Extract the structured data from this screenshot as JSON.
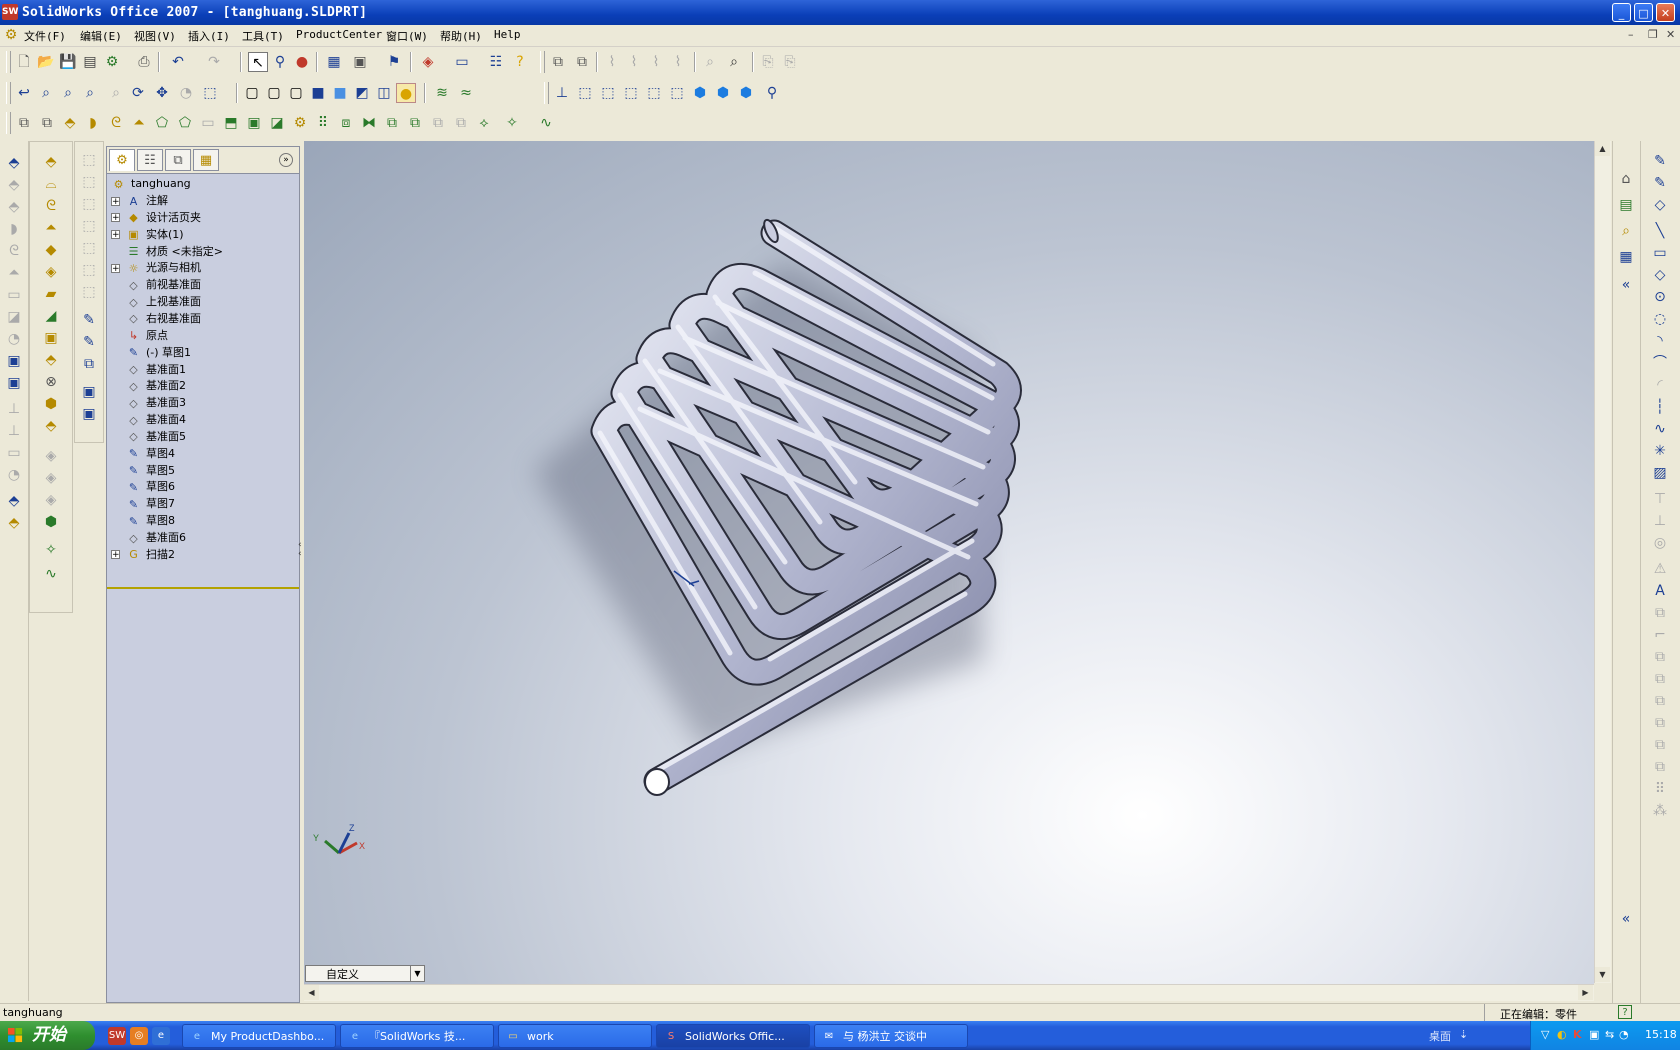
{
  "window": {
    "title": "SolidWorks Office 2007 - [tanghuang.SLDPRT]",
    "logo": "SW",
    "minimize": "_",
    "maximize": "□",
    "close": "✕"
  },
  "menu": {
    "items": [
      "文件(F)",
      "编辑(E)",
      "视图(V)",
      "插入(I)",
      "工具(T)",
      "ProductCenter",
      "窗口(W)",
      "帮助(H)",
      "Help"
    ],
    "doc_min": "–",
    "doc_restore": "❐",
    "doc_close": "✕"
  },
  "tree": {
    "root": "tanghuang",
    "items": [
      {
        "label": "注解",
        "icon": "annotations-icon",
        "glyph": "A",
        "expandable": true
      },
      {
        "label": "设计活页夹",
        "icon": "design-binder-icon",
        "glyph": "◆",
        "expandable": true
      },
      {
        "label": "实体(1)",
        "icon": "solid-bodies-icon",
        "glyph": "▣",
        "expandable": true
      },
      {
        "label": "材质 <未指定>",
        "icon": "material-icon",
        "glyph": "☰",
        "expandable": false
      },
      {
        "label": "光源与相机",
        "icon": "lights-cameras-icon",
        "glyph": "☼",
        "expandable": true
      },
      {
        "label": "前视基准面",
        "icon": "plane-icon",
        "glyph": "◇",
        "expandable": false
      },
      {
        "label": "上视基准面",
        "icon": "plane-icon",
        "glyph": "◇",
        "expandable": false
      },
      {
        "label": "右视基准面",
        "icon": "plane-icon",
        "glyph": "◇",
        "expandable": false
      },
      {
        "label": "原点",
        "icon": "origin-icon",
        "glyph": "↳",
        "expandable": false
      },
      {
        "label": "(-) 草图1",
        "icon": "sketch-icon",
        "glyph": "✎",
        "expandable": false
      },
      {
        "label": "基准面1",
        "icon": "plane-icon",
        "glyph": "◇",
        "expandable": false
      },
      {
        "label": "基准面2",
        "icon": "plane-icon",
        "glyph": "◇",
        "expandable": false
      },
      {
        "label": "基准面3",
        "icon": "plane-icon",
        "glyph": "◇",
        "expandable": false
      },
      {
        "label": "基准面4",
        "icon": "plane-icon",
        "glyph": "◇",
        "expandable": false
      },
      {
        "label": "基准面5",
        "icon": "plane-icon",
        "glyph": "◇",
        "expandable": false
      },
      {
        "label": "草图4",
        "icon": "sketch-icon",
        "glyph": "✎",
        "expandable": false
      },
      {
        "label": "草图5",
        "icon": "sketch-icon",
        "glyph": "✎",
        "expandable": false
      },
      {
        "label": "草图6",
        "icon": "sketch-icon",
        "glyph": "✎",
        "expandable": false
      },
      {
        "label": "草图7",
        "icon": "sketch-icon",
        "glyph": "✎",
        "expandable": false
      },
      {
        "label": "草图8",
        "icon": "sketch-icon",
        "glyph": "✎",
        "expandable": false
      },
      {
        "label": "基准面6",
        "icon": "plane-icon",
        "glyph": "◇",
        "expandable": false
      },
      {
        "label": "扫描2",
        "icon": "sweep-icon",
        "glyph": "G",
        "expandable": true
      }
    ]
  },
  "viewport": {
    "view_orientation": "自定义",
    "triad": {
      "x": "X",
      "y": "Y",
      "z": "Z"
    }
  },
  "status": {
    "left": "tanghuang",
    "right": "正在编辑：零件",
    "help": "?"
  },
  "taskbar": {
    "start": "开始",
    "tasks": [
      {
        "label": "My ProductDashbo...",
        "icon": "browser-icon",
        "active": false
      },
      {
        "label": "『SolidWorks 技...",
        "icon": "browser-icon",
        "active": false
      },
      {
        "label": "work",
        "icon": "folder-icon",
        "active": false
      },
      {
        "label": "SolidWorks Offic...",
        "icon": "solidworks-icon",
        "active": true
      },
      {
        "label": "与 杨洪立 交谈中",
        "icon": "chat-icon",
        "active": false
      }
    ],
    "desktop": "桌面",
    "clock": "15:18"
  },
  "colors": {
    "titlebar": "#0a3fb8",
    "tree_bg": "#c9cedf",
    "pipe": "#b9bdd6"
  }
}
